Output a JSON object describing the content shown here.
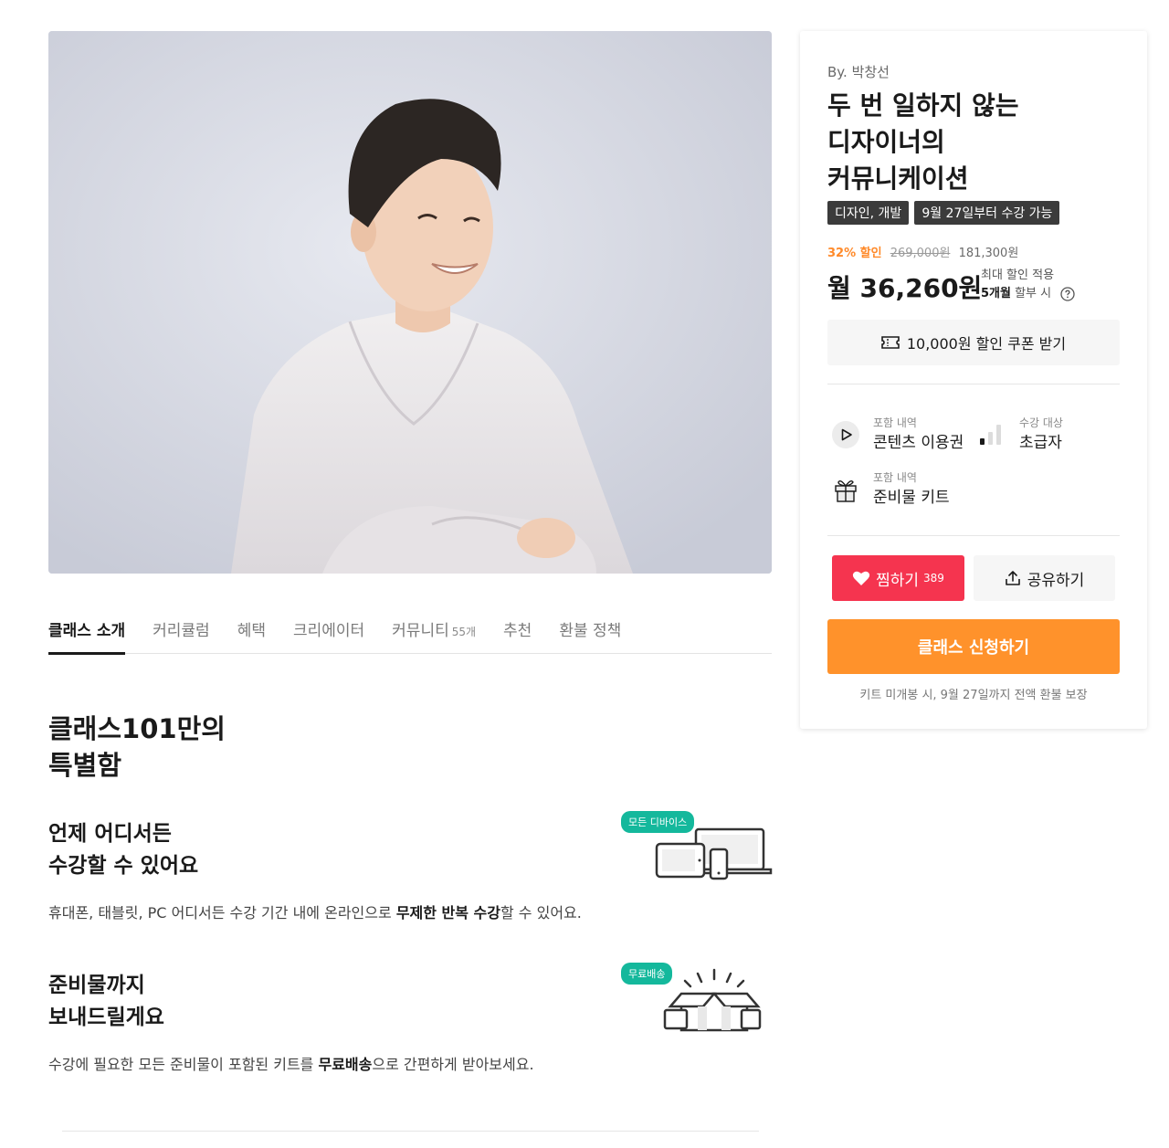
{
  "tabs": [
    {
      "label": "클래스 소개",
      "active": true
    },
    {
      "label": "커리큘럼"
    },
    {
      "label": "혜택"
    },
    {
      "label": "크리에이터"
    },
    {
      "label": "커뮤니티",
      "count": "55개"
    },
    {
      "label": "추천"
    },
    {
      "label": "환불 정책"
    }
  ],
  "intro": {
    "title_line1": "클래스101만의",
    "title_line2": "특별함",
    "features": [
      {
        "title_line1": "언제 어디서든",
        "title_line2": "수강할 수 있어요",
        "badge": "모든 디바이스",
        "desc_pre": "휴대폰, 태블릿, PC 어디서든 수강 기간 내에 온라인으로 ",
        "desc_bold": "무제한 반복 수강",
        "desc_post": "할 수 있어요.",
        "icon": "devices-icon"
      },
      {
        "title_line1": "준비물까지",
        "title_line2": "보내드릴게요",
        "badge": "무료배송",
        "desc_pre": "수강에 필요한 모든 준비물이 포함된 키트를 ",
        "desc_bold": "무료배송",
        "desc_post": "으로 간편하게 받아보세요.",
        "icon": "gift-box-icon"
      }
    ]
  },
  "card": {
    "by": "By. 박창선",
    "title_line1": "두 번 일하지 않는",
    "title_line2": "디자이너의",
    "title_line3": "커뮤니케이션",
    "tags": [
      "디자인, 개발",
      "9월 27일부터 수강 가능"
    ],
    "discount": "32% 할인",
    "original_price": "269,000원",
    "sale_price": "181,300원",
    "monthly_price": "월 36,260원",
    "monthly_note_line1": "최대 할인 적용",
    "monthly_note_bold": "5개월",
    "monthly_note_rest": " 할부 시",
    "coupon_label": "10,000원 할인 쿠폰 받기",
    "info": [
      {
        "label": "포함 내역",
        "value": "콘텐츠 이용권",
        "icon": "play-icon"
      },
      {
        "label": "수강 대상",
        "value": "초급자",
        "icon": "level-bars-icon"
      },
      {
        "label": "포함 내역",
        "value": "준비물 키트",
        "icon": "gift-icon"
      }
    ],
    "like_label": "찜하기",
    "like_count": "389",
    "share_label": "공유하기",
    "apply_label": "클래스 신청하기",
    "guarantee": "키트 미개봉 시, 9월 27일까지 전액 환불 보장"
  },
  "colors": {
    "accent_orange": "#ff922b",
    "discount_orange": "#ff8a2a",
    "like_red": "#f5344f",
    "badge_green": "#14b89c",
    "tag_dark": "#3b3b3b"
  }
}
